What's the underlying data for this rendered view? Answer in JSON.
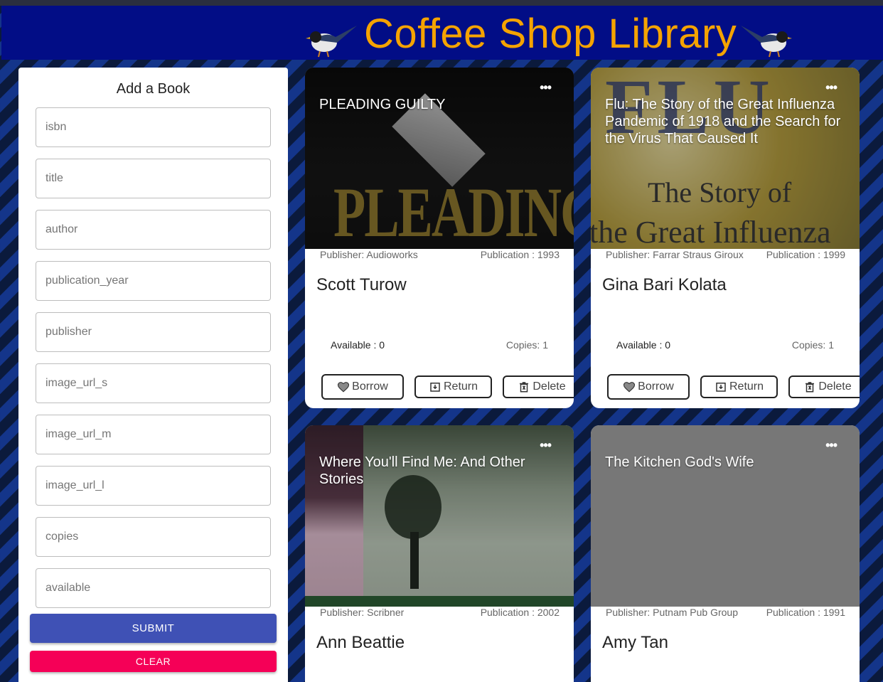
{
  "header": {
    "title": "Coffee Shop Library"
  },
  "form": {
    "title": "Add a Book",
    "fields": [
      {
        "placeholder": "isbn",
        "value": ""
      },
      {
        "placeholder": "title",
        "value": ""
      },
      {
        "placeholder": "author",
        "value": ""
      },
      {
        "placeholder": "publication_year",
        "value": ""
      },
      {
        "placeholder": "publisher",
        "value": ""
      },
      {
        "placeholder": "image_url_s",
        "value": ""
      },
      {
        "placeholder": "image_url_m",
        "value": ""
      },
      {
        "placeholder": "image_url_l",
        "value": ""
      },
      {
        "placeholder": "copies",
        "value": ""
      },
      {
        "placeholder": "available",
        "value": ""
      }
    ],
    "submit_label": "SUBMIT",
    "clear_label": "CLEAR"
  },
  "card_labels": {
    "borrow": "Borrow",
    "return": "Return",
    "delete": "Delete",
    "menu": "•••"
  },
  "books": [
    {
      "title": "PLEADING GUILTY",
      "publisher": "Publisher: Audioworks",
      "publication": "Publication : 1993",
      "author": "Scott Turow",
      "available": "Available : 0",
      "copies": "Copies: 1",
      "cover_text": "PLEADING"
    },
    {
      "title": "Flu: The Story of the Great Influenza Pandemic of 1918 and the Search for the Virus That Caused It",
      "publisher": "Publisher: Farrar Straus Giroux",
      "publication": "Publication : 1999",
      "author": "Gina Bari Kolata",
      "available": "Available : 0",
      "copies": "Copies: 1",
      "cover_text": "FLU",
      "cover_text2": "The Story of",
      "cover_text3": "the Great Influenza"
    },
    {
      "title": "Where You'll Find Me: And Other Stories",
      "publisher": "Publisher: Scribner",
      "publication": "Publication : 2002",
      "author": "Ann Beattie"
    },
    {
      "title": "The Kitchen God's Wife",
      "publisher": "Publisher: Putnam Pub Group",
      "publication": "Publication : 1991",
      "author": "Amy Tan"
    }
  ]
}
